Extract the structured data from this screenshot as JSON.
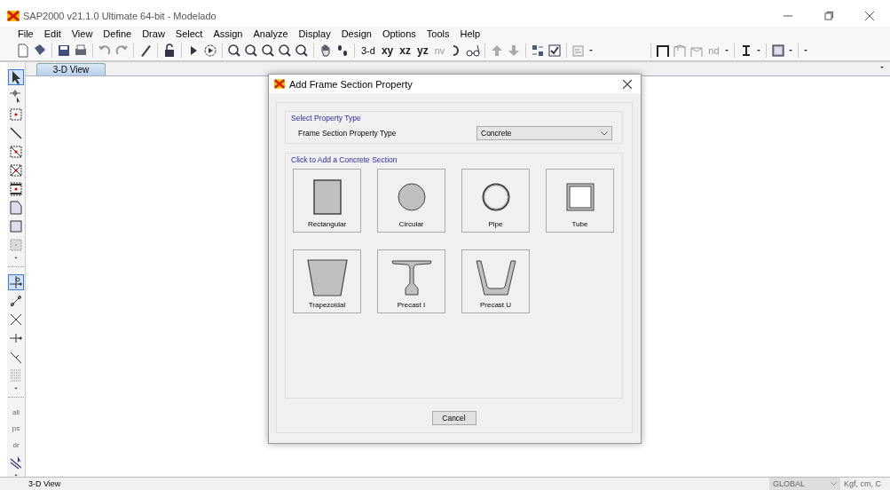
{
  "window": {
    "title": "SAP2000 v21.1.0 Ultimate 64-bit - Modelado"
  },
  "menu": [
    "File",
    "Edit",
    "View",
    "Define",
    "Draw",
    "Select",
    "Assign",
    "Analyze",
    "Display",
    "Design",
    "Options",
    "Tools",
    "Help"
  ],
  "toolbar": {
    "view_buttons": [
      "3-d",
      "xy",
      "xz",
      "yz",
      "nv"
    ],
    "nd_button": "nd"
  },
  "tabs": [
    {
      "label": "3-D View",
      "selected": true
    }
  ],
  "left_toolbar": [
    {
      "kind": "pointer",
      "selected": true
    },
    {
      "kind": "reshaper",
      "selected": false
    },
    {
      "kind": "point",
      "selected": false
    },
    {
      "kind": "line",
      "selected": false
    },
    {
      "kind": "rect-line",
      "selected": false
    },
    {
      "kind": "cross-line",
      "selected": false
    },
    {
      "kind": "frame",
      "selected": false
    },
    {
      "kind": "poly",
      "selected": false
    },
    {
      "kind": "rect",
      "selected": false
    },
    {
      "kind": "area",
      "selected": false
    },
    {
      "kind": "dropdown"
    },
    {
      "kind": "separator"
    },
    {
      "kind": "snap",
      "selected": true
    },
    {
      "kind": "snap-line",
      "selected": false
    },
    {
      "kind": "snap-cross",
      "selected": false
    },
    {
      "kind": "snap-mid",
      "selected": false
    },
    {
      "kind": "snap-perp",
      "selected": false
    },
    {
      "kind": "grid",
      "selected": false
    },
    {
      "kind": "dropdown"
    },
    {
      "kind": "separator"
    },
    {
      "kind": "select-text",
      "label": "all",
      "selected": false
    },
    {
      "kind": "select-text",
      "label": "ps",
      "selected": false
    },
    {
      "kind": "select-text",
      "label": "dr",
      "selected": false
    },
    {
      "kind": "select-line",
      "selected": false
    },
    {
      "kind": "dropdown"
    }
  ],
  "dialog": {
    "title": "Add Frame Section Property",
    "type_group": {
      "title": "Select Property Type",
      "label": "Frame Section Property Type",
      "value": "Concrete"
    },
    "sections_group": {
      "title": "Click to Add a Concrete Section",
      "sections": [
        {
          "kind": "rectangular",
          "label": "Rectangular"
        },
        {
          "kind": "circular",
          "label": "Circular"
        },
        {
          "kind": "pipe",
          "label": "Pipe"
        },
        {
          "kind": "tube",
          "label": "Tube"
        },
        {
          "kind": "trapezoidal",
          "label": "Trapezoidal"
        },
        {
          "kind": "precast-i",
          "label": "Precast I"
        },
        {
          "kind": "precast-u",
          "label": "Precast U"
        }
      ]
    },
    "buttons": [
      "Cancel"
    ]
  },
  "status_bar": {
    "view": "3-D View",
    "coordinate_system": "GLOBAL",
    "units": "Kgf, cm, C"
  }
}
